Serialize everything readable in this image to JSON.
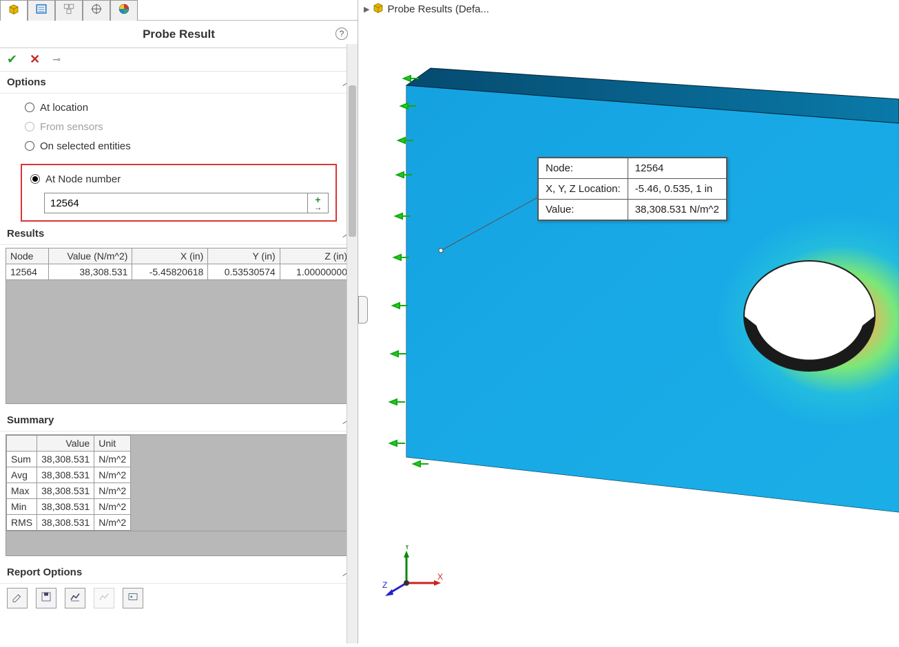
{
  "breadcrumb": {
    "label": "Probe Results  (Defa..."
  },
  "panel": {
    "title": "Probe Result",
    "help": "?",
    "sections": {
      "options": {
        "title": "Options",
        "radios": {
          "at_location": "At location",
          "from_sensors": "From sensors",
          "on_selected": "On selected entities",
          "at_node": "At Node number"
        },
        "node_value": "12564"
      },
      "results": {
        "title": "Results",
        "headers": {
          "node": "Node",
          "value": "Value (N/m^2)",
          "x": "X (in)",
          "y": "Y (in)",
          "z": "Z (in)"
        },
        "row": {
          "node": "12564",
          "value": "38,308.531",
          "x": "-5.45820618",
          "y": "0.53530574",
          "z": "1.00000000"
        }
      },
      "summary": {
        "title": "Summary",
        "headers": {
          "value": "Value",
          "unit": "Unit"
        },
        "rows": {
          "sum": {
            "label": "Sum",
            "value": "38,308.531",
            "unit": "N/m^2"
          },
          "avg": {
            "label": "Avg",
            "value": "38,308.531",
            "unit": "N/m^2"
          },
          "max": {
            "label": "Max",
            "value": "38,308.531",
            "unit": "N/m^2"
          },
          "min": {
            "label": "Min",
            "value": "38,308.531",
            "unit": "N/m^2"
          },
          "rms": {
            "label": "RMS",
            "value": "38,308.531",
            "unit": "N/m^2"
          }
        }
      },
      "report": {
        "title": "Report Options"
      }
    }
  },
  "callout": {
    "node_k": "Node:",
    "node_v": "12564",
    "loc_k": "X, Y, Z Location:",
    "loc_v": "-5.46, 0.535, 1 in",
    "val_k": "Value:",
    "val_v": "38,308.531 N/m^2"
  },
  "triad": {
    "x": "X",
    "y": "Y",
    "z": "Z"
  }
}
